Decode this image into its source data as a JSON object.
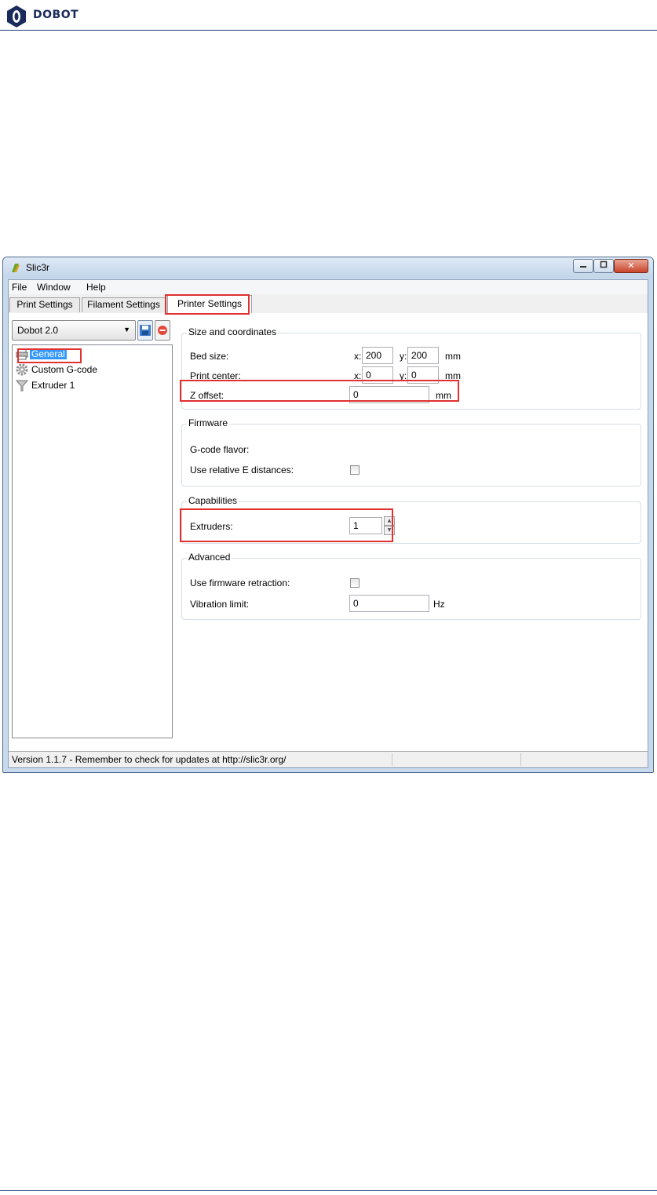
{
  "header": {
    "brand": "DOBOT"
  },
  "colors": {
    "highlight": "#e03030",
    "doc_rule": "#1f3a7a",
    "selection": "#3399ff"
  },
  "window": {
    "title": "Slic3r",
    "title_icon": "slic3r-app-icon",
    "controls": {
      "minimize": "minimize-icon",
      "maximize": "maximize-icon",
      "close": "✕"
    }
  },
  "menu": [
    "File",
    "Window",
    "Help"
  ],
  "tabs": [
    {
      "label": "Print Settings",
      "active": false
    },
    {
      "label": "Filament Settings",
      "active": false
    },
    {
      "label": "Printer Settings",
      "active": true
    }
  ],
  "preset": {
    "value": "Dobot 2.0",
    "save_icon": "save-icon",
    "delete_icon": "delete-icon"
  },
  "tree": [
    {
      "label": "General",
      "icon": "printer-icon",
      "selected": true
    },
    {
      "label": "Custom G-code",
      "icon": "gear-icon",
      "selected": false
    },
    {
      "label": "Extruder 1",
      "icon": "funnel-icon",
      "selected": false
    }
  ],
  "size": {
    "title": "Size and coordinates",
    "bed_label": "Bed size:",
    "bed_x_prefix": "x:",
    "bed_x": "200",
    "bed_y_prefix": "y:",
    "bed_y": "200",
    "bed_unit": "mm",
    "center_label": "Print center:",
    "center_x_prefix": "x:",
    "center_x": "0",
    "center_y_prefix": "y:",
    "center_y": "0",
    "center_unit": "mm",
    "z_label": "Z offset:",
    "z_value": "0",
    "z_unit": "mm"
  },
  "firmware": {
    "title": "Firmware",
    "gcode_label": "G-code flavor:",
    "relative_e_label": "Use relative E distances:",
    "relative_e_checked": false
  },
  "capabilities": {
    "title": "Capabilities",
    "extruders_label": "Extruders:",
    "extruders_value": "1"
  },
  "advanced": {
    "title": "Advanced",
    "retraction_label": "Use firmware retraction:",
    "retraction_checked": false,
    "vibration_label": "Vibration limit:",
    "vibration_value": "0",
    "vibration_unit": "Hz"
  },
  "status": {
    "text": "Version 1.1.7 - Remember to check for updates at http://slic3r.org/"
  }
}
